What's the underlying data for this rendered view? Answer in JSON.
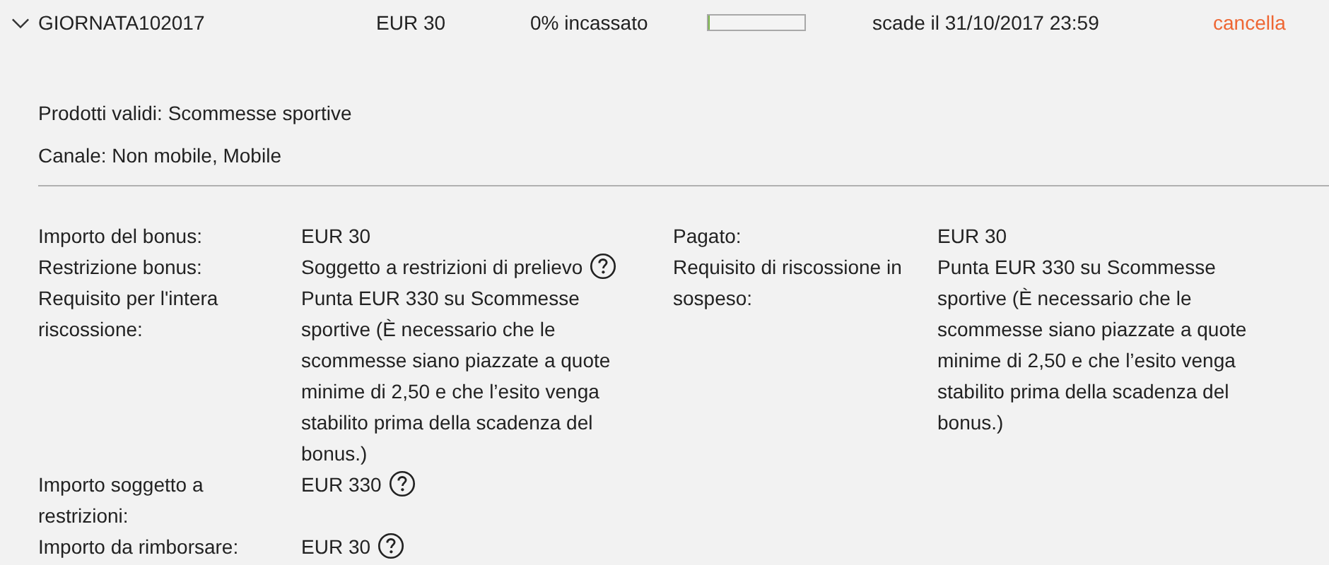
{
  "bonus": {
    "expanded": true,
    "code": "GIORNATA102017",
    "amount": "EUR 30",
    "collected": "0% incassato",
    "level": 0,
    "expiry": "scade il 31/10/2017 23:59",
    "cancel": "cancella"
  },
  "info": [
    "Prodotti validi: Scommesse sportive",
    "Canale: Non mobile, Mobile"
  ],
  "details_left": [
    {
      "label": "Importo del bonus:",
      "value": "EUR 30",
      "help": false
    },
    {
      "label": "Restrizione bonus:",
      "value": "Soggetto a restrizioni di prelievo",
      "help": true
    },
    {
      "label": "Requisito per l'intera riscossione:",
      "value": "Punta EUR 330 su Scommesse sportive (È necessario che le scommesse siano piazzate a quote minime di 2,50 e che l’esito venga stabilito prima della scadenza del bonus.)",
      "help": false
    },
    {
      "label": "Importo soggetto a restrizioni:",
      "value": "EUR 330",
      "help": true
    },
    {
      "label": "Importo da rimborsare:",
      "value": "EUR 30",
      "help": true
    }
  ],
  "details_right": [
    {
      "label": "Pagato:",
      "value": "EUR 30",
      "help": false
    },
    {
      "label": "Requisito di riscossione in sospeso:",
      "value": "Punta EUR 330 su Scommesse sportive (È necessario che le scommesse siano piazzate a quote minime di 2,50 e che l’esito venga stabilito prima della scadenza del bonus.)",
      "help": false
    }
  ]
}
